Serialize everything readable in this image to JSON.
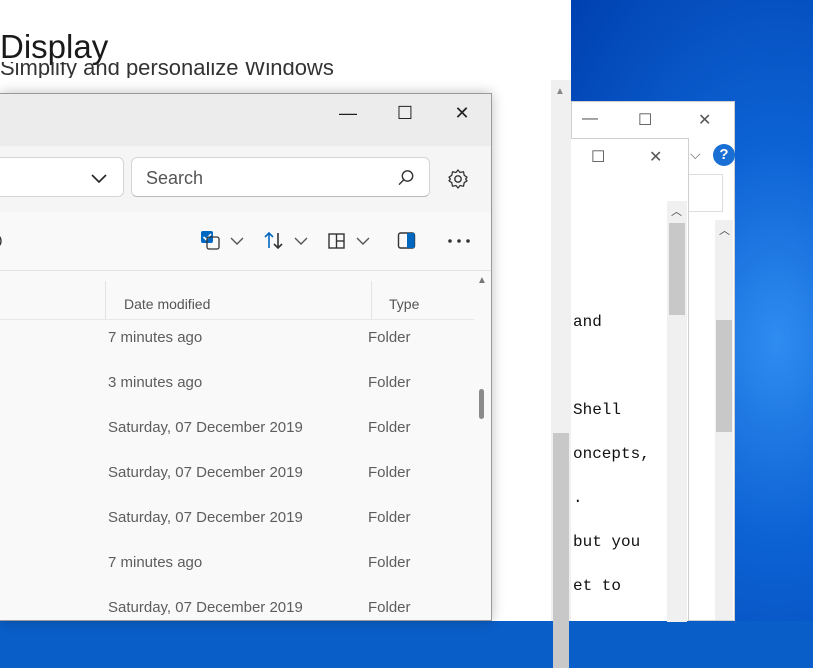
{
  "settings": {
    "title": "Display",
    "subtitle": "Simplify and personalize Windows"
  },
  "explorer": {
    "window_controls": {
      "minimize": "—",
      "maximize": "☐",
      "close": "✕"
    },
    "search": {
      "placeholder": "Search"
    },
    "columns": {
      "date_modified": "Date modified",
      "type": "Type"
    },
    "rows": [
      {
        "date": "7 minutes ago",
        "type": "Folder"
      },
      {
        "date": "3 minutes ago",
        "type": "Folder"
      },
      {
        "date": "Saturday, 07 December 2019",
        "type": "Folder"
      },
      {
        "date": "Saturday, 07 December 2019",
        "type": "Folder"
      },
      {
        "date": "Saturday, 07 December 2019",
        "type": "Folder"
      },
      {
        "date": "7 minutes ago",
        "type": "Folder"
      },
      {
        "date": "Saturday, 07 December 2019",
        "type": "Folder"
      }
    ]
  },
  "notepad_back": {
    "minimize": "—",
    "maximize": "☐",
    "close": "✕",
    "help": "?"
  },
  "notepad_front": {
    "maximize": "☐",
    "close": "✕",
    "lines": [
      "and",
      "Shell",
      "oncepts,",
      ".",
      " but you",
      "et to"
    ]
  },
  "colors": {
    "accent": "#0067c0",
    "desktop": "#0d63d4",
    "help_badge": "#1a6fd4"
  }
}
